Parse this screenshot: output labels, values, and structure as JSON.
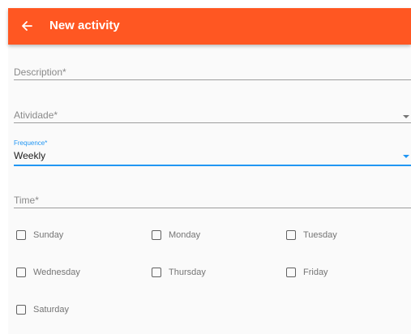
{
  "appbar": {
    "title": "New activity",
    "back_icon": "arrow-left-icon",
    "color": "#ff5722"
  },
  "form": {
    "description": {
      "placeholder": "Description*",
      "value": ""
    },
    "atividade": {
      "placeholder": "Atividade*",
      "value": ""
    },
    "frequence": {
      "label": "Frequence*",
      "value": "Weekly"
    },
    "time": {
      "placeholder": "Time*",
      "value": ""
    }
  },
  "days": [
    {
      "label": "Sunday",
      "checked": false
    },
    {
      "label": "Monday",
      "checked": false
    },
    {
      "label": "Tuesday",
      "checked": false
    },
    {
      "label": "Wednesday",
      "checked": false
    },
    {
      "label": "Thursday",
      "checked": false
    },
    {
      "label": "Friday",
      "checked": false
    },
    {
      "label": "Saturday",
      "checked": false
    }
  ],
  "colors": {
    "accent": "#2196f3",
    "appbar": "#ff5722"
  }
}
